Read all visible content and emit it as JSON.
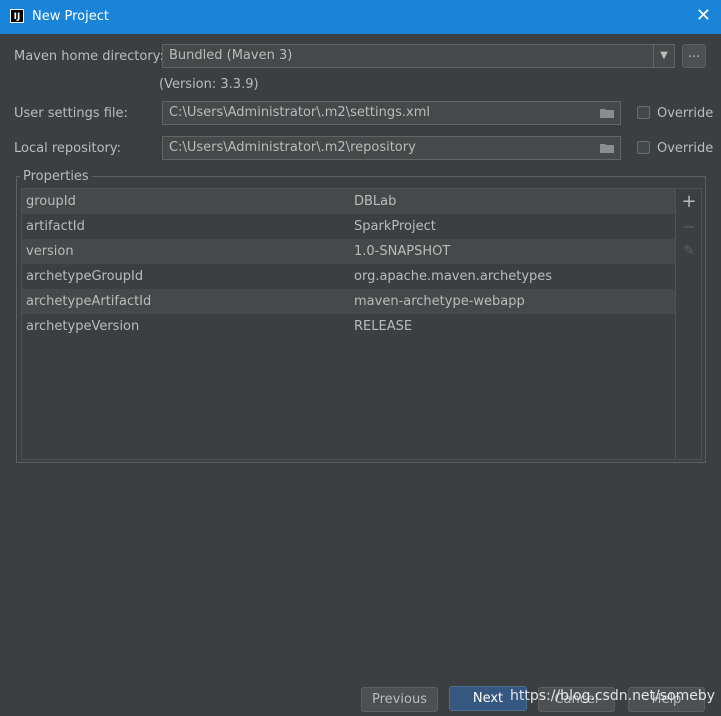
{
  "window": {
    "app_icon_text": "IJ",
    "title": "New Project",
    "close_glyph": "✕"
  },
  "maven_home": {
    "label": "Maven home directory:",
    "value": "Bundled (Maven 3)",
    "browse_label": "...",
    "version_text": "(Version: 3.3.9)"
  },
  "user_settings": {
    "label": "User settings file:",
    "value": "C:\\Users\\Administrator\\.m2\\settings.xml",
    "override_label": "Override",
    "override_checked": false
  },
  "local_repository": {
    "label": "Local repository:",
    "value": "C:\\Users\\Administrator\\.m2\\repository",
    "override_label": "Override",
    "override_checked": false
  },
  "properties": {
    "title": "Properties",
    "rows": [
      {
        "key": "groupId",
        "value": "DBLab"
      },
      {
        "key": "artifactId",
        "value": "SparkProject"
      },
      {
        "key": "version",
        "value": "1.0-SNAPSHOT"
      },
      {
        "key": "archetypeGroupId",
        "value": "org.apache.maven.archetypes"
      },
      {
        "key": "archetypeArtifactId",
        "value": "maven-archetype-webapp"
      },
      {
        "key": "archetypeVersion",
        "value": "RELEASE"
      }
    ],
    "tools": {
      "add": "+",
      "remove": "−",
      "edit": "✎"
    }
  },
  "footer": {
    "previous_label": "Previous",
    "next_label": "Next",
    "cancel_label": "Cancel",
    "help_label": "Help",
    "watermark": "https://blog.csdn.net/someby"
  },
  "colors": {
    "titlebar": "#1a84d8",
    "background": "#3c3f41",
    "default_button": "#365880"
  }
}
